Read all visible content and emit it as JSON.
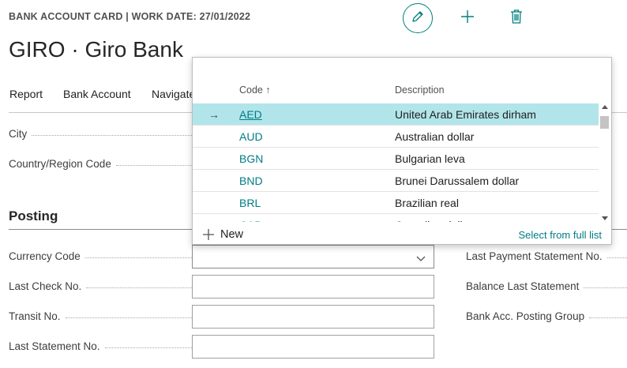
{
  "header": {
    "caption": "BANK ACCOUNT CARD | WORK DATE: 27/01/2022",
    "title": "GIRO · Giro Bank",
    "actions": [
      {
        "name": "edit",
        "icon": "pencil-icon"
      },
      {
        "name": "new",
        "icon": "plus-icon"
      },
      {
        "name": "delete",
        "icon": "trash-icon"
      }
    ]
  },
  "menu": [
    "Report",
    "Bank Account",
    "Navigate"
  ],
  "general_fields": [
    "City",
    "Country/Region Code"
  ],
  "posting": {
    "title": "Posting",
    "left_fields": [
      "Currency Code",
      "Last Check No.",
      "Transit No.",
      "Last Statement No."
    ],
    "right_fields": [
      "Last Payment Statement No.",
      "Balance Last Statement",
      "Bank Acc. Posting Group"
    ]
  },
  "lookup": {
    "columns": {
      "code": "Code ↑",
      "description": "Description"
    },
    "selected_index": 0,
    "rows": [
      {
        "code": "AED",
        "description": "United Arab Emirates dirham"
      },
      {
        "code": "AUD",
        "description": "Australian dollar"
      },
      {
        "code": "BGN",
        "description": "Bulgarian leva"
      },
      {
        "code": "BND",
        "description": "Brunei Darussalem dollar"
      },
      {
        "code": "BRL",
        "description": "Brazilian real"
      },
      {
        "code": "CAD",
        "description": "Canadian dollar"
      }
    ],
    "selected_arrow": "→",
    "new_label": "New",
    "full_list_label": "Select from full list"
  },
  "colors": {
    "accent": "#00807f",
    "selected_row": "#b1e5ea",
    "link": "#007c85"
  }
}
